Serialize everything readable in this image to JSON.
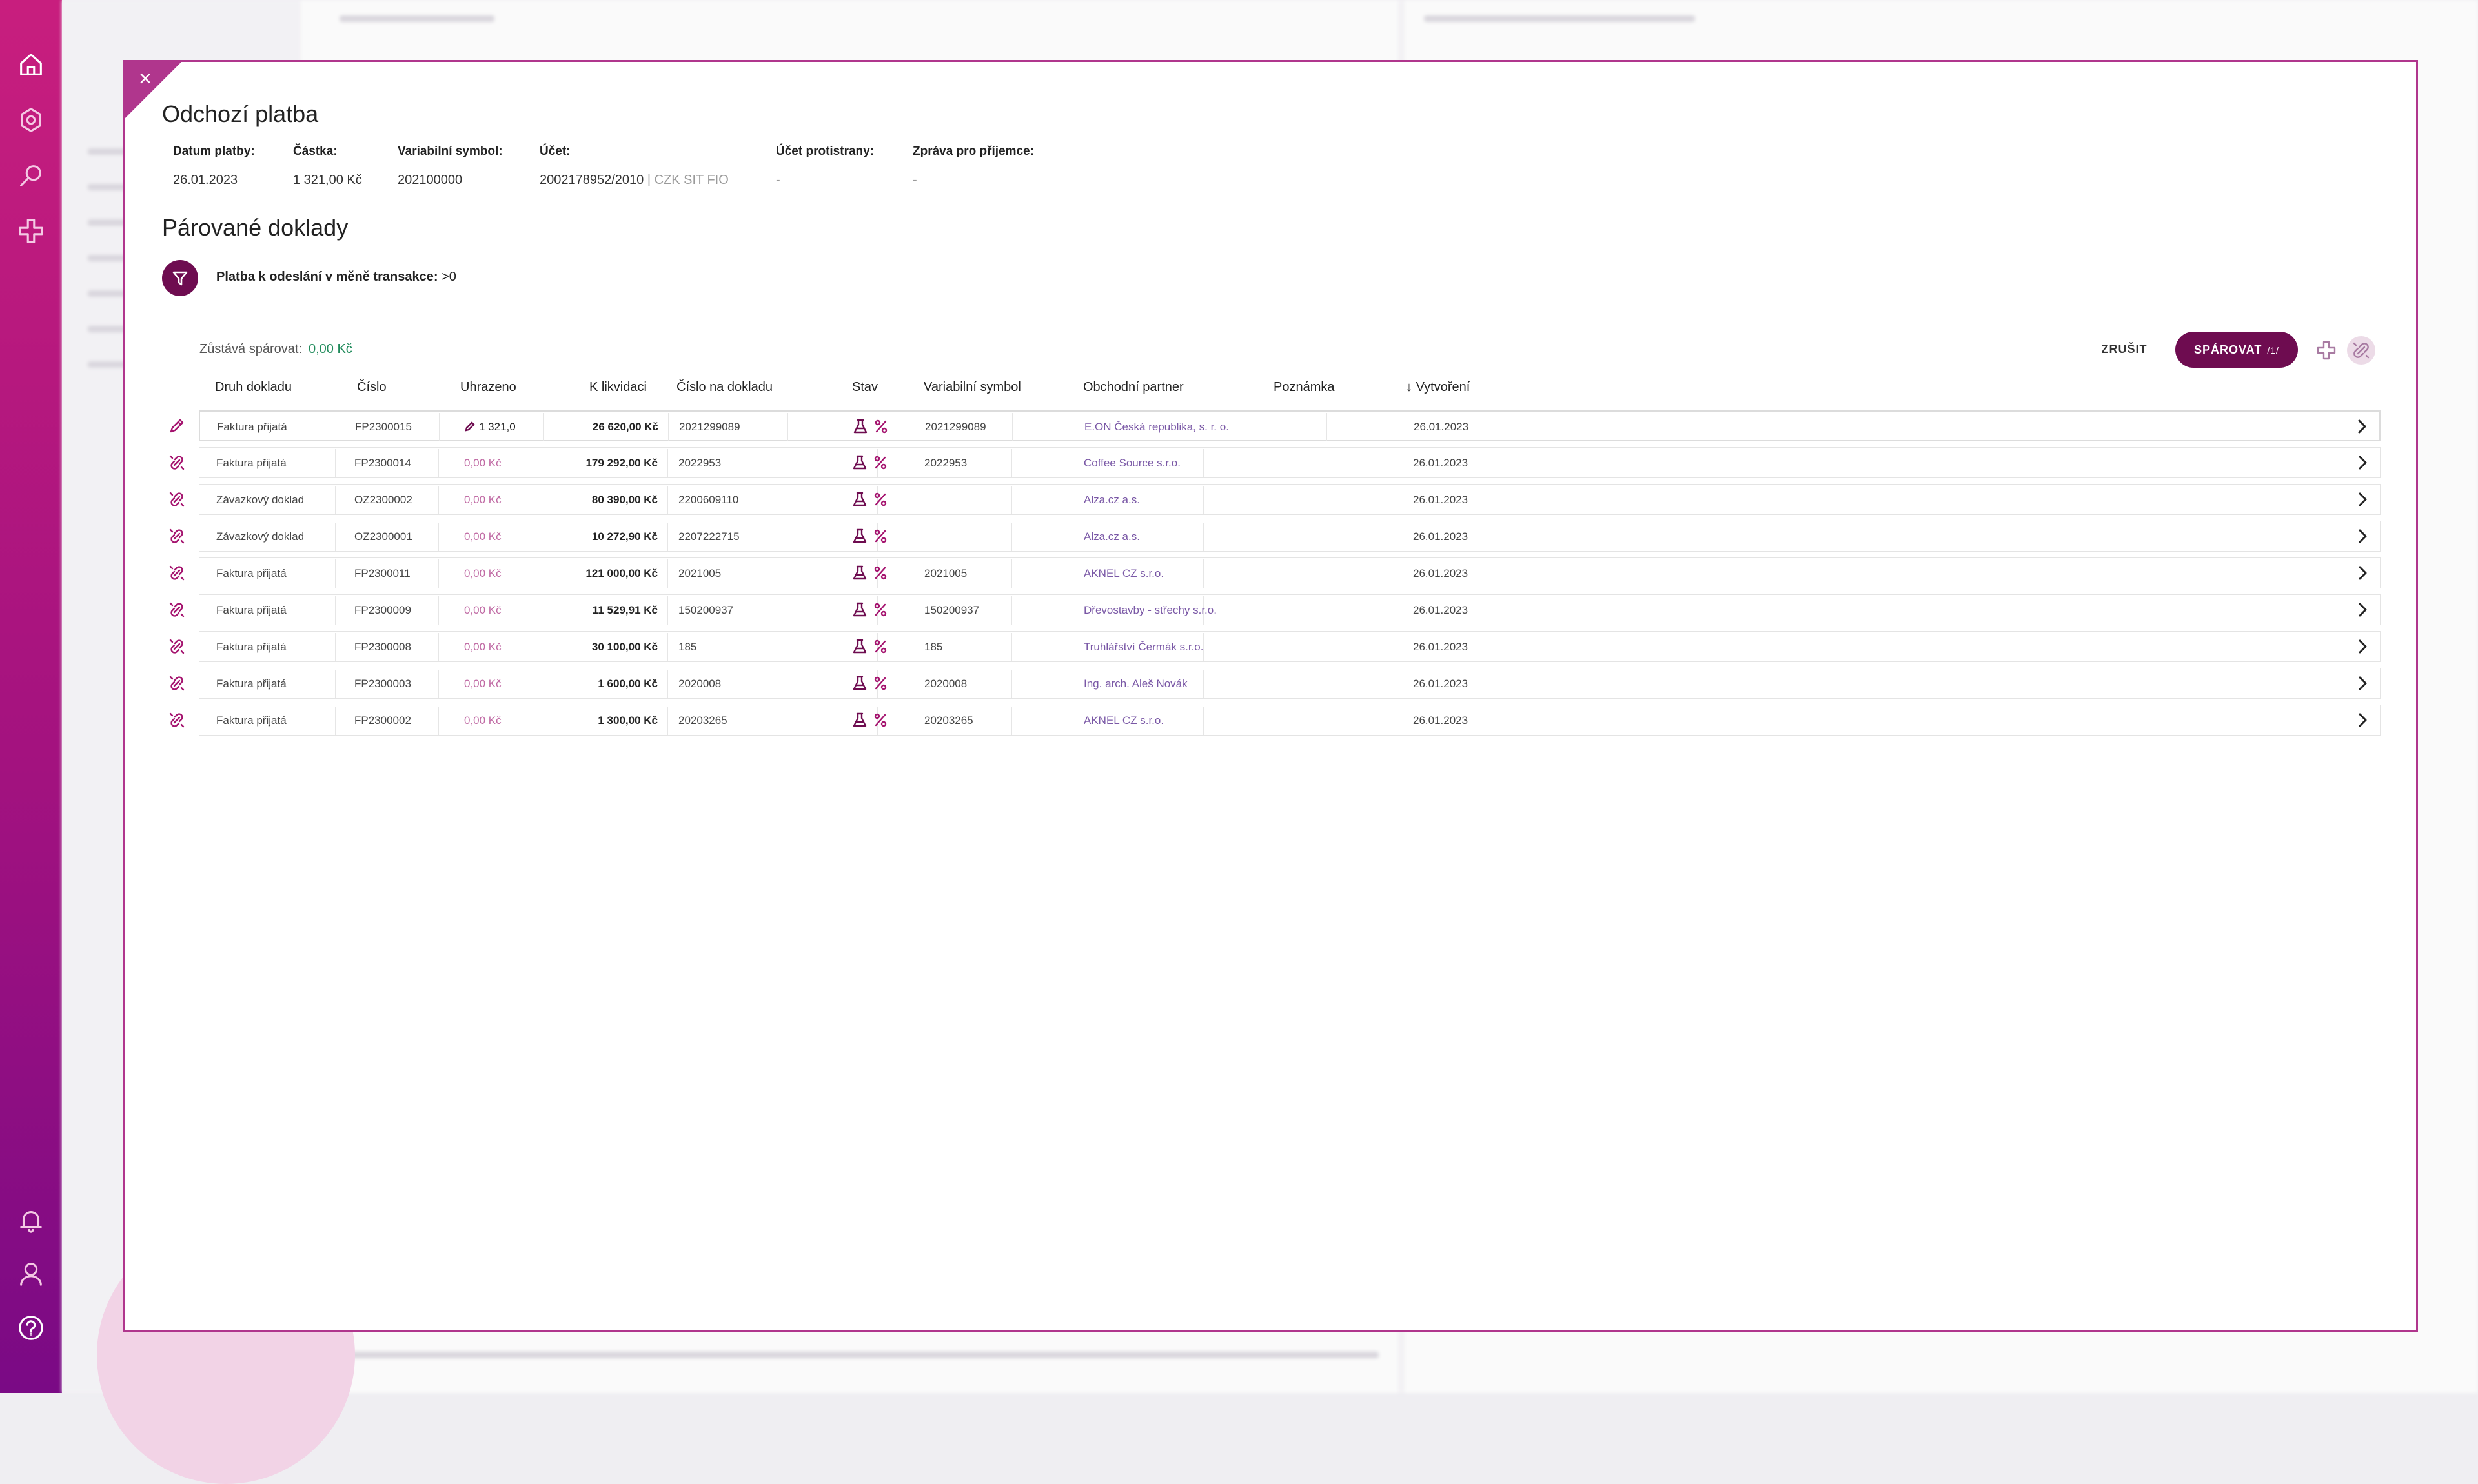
{
  "sidebar": {
    "top_icons": [
      "home-icon",
      "settings-icon",
      "search-icon",
      "add-icon"
    ],
    "bottom_icons": [
      "bell-icon",
      "user-icon",
      "help-icon"
    ]
  },
  "modal": {
    "title": "Odchozí platba",
    "close_label": "×",
    "info": {
      "date_label": "Datum platby:",
      "date_value": "26.01.2023",
      "amount_label": "Částka:",
      "amount_value": "1 321,00 Kč",
      "vs_label": "Variabilní symbol:",
      "vs_value": "202100000",
      "account_label": "Účet:",
      "account_value": "2002178952/2010",
      "account_suffix": "| CZK SIT FIO",
      "counter_label": "Účet protistrany:",
      "counter_value": "-",
      "message_label": "Zpráva pro příjemce:",
      "message_value": "-"
    },
    "subtitle": "Párované doklady",
    "filter": {
      "label": "Platba k odeslání v měně transakce:",
      "value": ">0"
    },
    "remaining": {
      "label": "Zůstává spárovat:",
      "value": "0,00 Kč"
    },
    "actions": {
      "cancel_label": "ZRUŠIT",
      "pair_label": "SPÁROVAT",
      "pair_count": "/1/"
    },
    "table": {
      "headers": {
        "type": "Druh dokladu",
        "number": "Číslo",
        "paid": "Uhrazeno",
        "to_settle": "K likvidaci",
        "doc_number": "Číslo na dokladu",
        "status": "Stav",
        "vs": "Variabilní symbol",
        "partner": "Obchodní partner",
        "note": "Poznámka",
        "created": "Vytvoření",
        "sort_arrow": "↓"
      },
      "rows": [
        {
          "type": "Faktura přijatá",
          "number": "FP2300015",
          "paid": "1 321,0",
          "to_settle": "26 620,00 Kč",
          "doc_number": "2021299089",
          "vs": "2021299089",
          "partner": "E.ON Česká republika, s. r. o.",
          "note": "",
          "created": "26.01.2023",
          "icon": "pencil-icon"
        },
        {
          "type": "Faktura přijatá",
          "number": "FP2300014",
          "paid": "0,00 Kč",
          "to_settle": "179 292,00 Kč",
          "doc_number": "2022953",
          "vs": "2022953",
          "partner": "Coffee Source s.r.o.",
          "note": "",
          "created": "26.01.2023",
          "icon": "unlink-icon"
        },
        {
          "type": "Závazkový doklad",
          "number": "OZ2300002",
          "paid": "0,00 Kč",
          "to_settle": "80 390,00 Kč",
          "doc_number": "2200609110",
          "vs": "",
          "partner": "Alza.cz a.s.",
          "note": "",
          "created": "26.01.2023",
          "icon": "unlink-icon"
        },
        {
          "type": "Závazkový doklad",
          "number": "OZ2300001",
          "paid": "0,00 Kč",
          "to_settle": "10 272,90 Kč",
          "doc_number": "2207222715",
          "vs": "",
          "partner": "Alza.cz a.s.",
          "note": "",
          "created": "26.01.2023",
          "icon": "unlink-icon"
        },
        {
          "type": "Faktura přijatá",
          "number": "FP2300011",
          "paid": "0,00 Kč",
          "to_settle": "121 000,00 Kč",
          "doc_number": "2021005",
          "vs": "2021005",
          "partner": "AKNEL CZ s.r.o.",
          "note": "",
          "created": "26.01.2023",
          "icon": "unlink-icon"
        },
        {
          "type": "Faktura přijatá",
          "number": "FP2300009",
          "paid": "0,00 Kč",
          "to_settle": "11 529,91 Kč",
          "doc_number": "150200937",
          "vs": "150200937",
          "partner": "Dřevostavby - střechy s.r.o.",
          "note": "",
          "created": "26.01.2023",
          "icon": "unlink-icon"
        },
        {
          "type": "Faktura přijatá",
          "number": "FP2300008",
          "paid": "0,00 Kč",
          "to_settle": "30 100,00 Kč",
          "doc_number": "185",
          "vs": "185",
          "partner": "Truhlářství Čermák s.r.o.",
          "note": "",
          "created": "26.01.2023",
          "icon": "unlink-icon"
        },
        {
          "type": "Faktura přijatá",
          "number": "FP2300003",
          "paid": "0,00 Kč",
          "to_settle": "1 600,00 Kč",
          "doc_number": "2020008",
          "vs": "2020008",
          "partner": "Ing. arch. Aleš Novák",
          "note": "",
          "created": "26.01.2023",
          "icon": "unlink-icon"
        },
        {
          "type": "Faktura přijatá",
          "number": "FP2300002",
          "paid": "0,00 Kč",
          "to_settle": "1 300,00 Kč",
          "doc_number": "20203265",
          "vs": "20203265",
          "partner": "AKNEL CZ s.r.o.",
          "note": "",
          "created": "26.01.2023",
          "icon": "unlink-icon"
        }
      ]
    }
  },
  "colors": {
    "brand": "#6e0c50",
    "accent": "#b0368d",
    "success": "#1f8a5a",
    "partner_link": "#7a58a6"
  }
}
